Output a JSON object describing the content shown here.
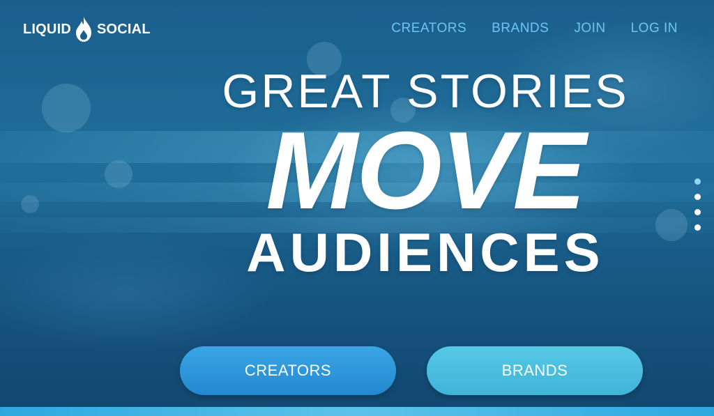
{
  "brand": {
    "name_left": "LIQUID",
    "name_right": "SOCIAL",
    "logo_icon": "flame-drop-icon"
  },
  "nav": {
    "items": [
      "CREATORS",
      "BRANDS",
      "JOIN",
      "LOG IN"
    ]
  },
  "hero": {
    "line1": "GREAT STORIES",
    "line2": "MOVE",
    "line3": "AUDIENCES"
  },
  "slider": {
    "count": 4,
    "active_index": 0
  },
  "cta": {
    "creators_label": "CREATORS",
    "brands_label": "BRANDS"
  },
  "colors": {
    "nav_link": "#6ec6ef",
    "creators_button": "#2a92d8",
    "brands_button": "#4dbfe0",
    "active_dot": "#8fd8f4"
  }
}
